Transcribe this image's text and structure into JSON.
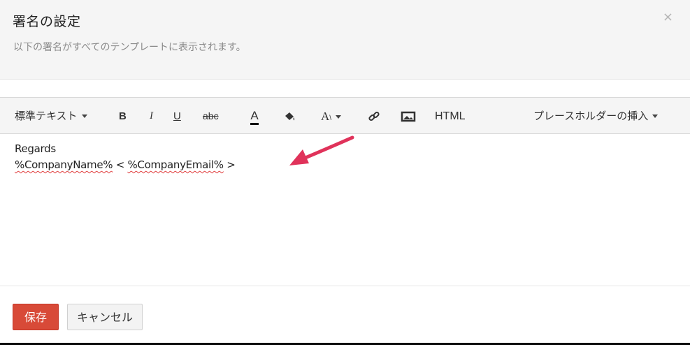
{
  "dialog": {
    "title": "署名の設定",
    "subtitle": "以下の署名がすべてのテンプレートに表示されます。",
    "close_glyph": "×"
  },
  "toolbar": {
    "format_label": "標準テキスト",
    "bold_label": "B",
    "italic_label": "I",
    "underline_label": "U",
    "strike_label": "abc",
    "font_color_label": "A",
    "font_size_label": "A",
    "html_label": "HTML",
    "placeholder_label": "プレースホルダーの挿入"
  },
  "editor": {
    "line1": "Regards",
    "company_name": "%CompanyName%",
    "lt": " < ",
    "company_email": "%CompanyEmail%",
    "gt": " >"
  },
  "buttons": {
    "save_label": "保存",
    "cancel_label": "キャンセル"
  },
  "colors": {
    "accent_red": "#d84a38",
    "arrow": "#e0325a"
  }
}
